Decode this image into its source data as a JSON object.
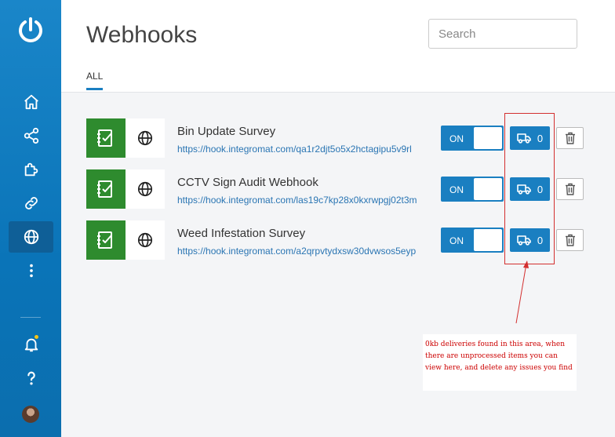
{
  "header": {
    "title": "Webhooks",
    "search_placeholder": "Search",
    "tabs": [
      {
        "label": "ALL",
        "active": true
      }
    ]
  },
  "sidebar": {
    "items": [
      {
        "icon": "home-icon"
      },
      {
        "icon": "share-icon"
      },
      {
        "icon": "puzzle-icon"
      },
      {
        "icon": "link-icon"
      },
      {
        "icon": "globe-icon",
        "active": true
      },
      {
        "icon": "more-vertical-icon"
      },
      {
        "icon": "bell-icon",
        "notification": true
      },
      {
        "icon": "help-icon"
      },
      {
        "icon": "avatar"
      }
    ]
  },
  "webhooks": [
    {
      "name": "Bin Update Survey",
      "url": "https://hook.integromat.com/qa1r2djt5o5x2hctagipu5v9rl",
      "status": "ON",
      "deliveries": "0"
    },
    {
      "name": "CCTV Sign Audit Webhook",
      "url": "https://hook.integromat.com/las19c7kp28x0kxrwpgj02t3m",
      "status": "ON",
      "deliveries": "0"
    },
    {
      "name": "Weed Infestation Survey",
      "url": "https://hook.integromat.com/a2qrpvtydxsw30dvwsos5eyp",
      "status": "ON",
      "deliveries": "0"
    }
  ],
  "annotation": {
    "text": "0kb deliveries found in this area, when there are unprocessed items you can view here, and delete any issues you find",
    "color": "#cc0000"
  },
  "colors": {
    "accent": "#1a7fc1",
    "app_icon": "#2e8b2e",
    "sidebar": "#0a74b8"
  }
}
